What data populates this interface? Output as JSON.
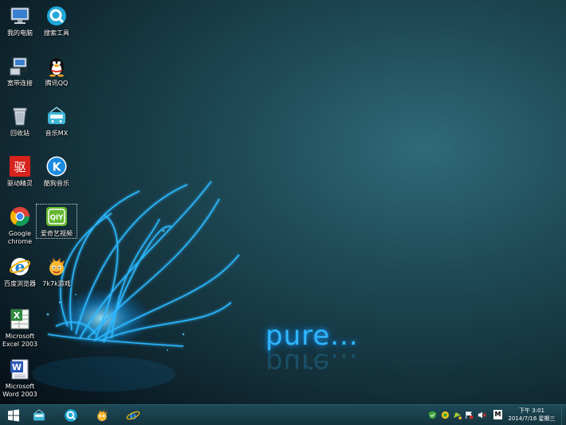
{
  "wallpaper": {
    "brand_text": "pure..."
  },
  "desktop_icons": [
    {
      "label": "我的电脑",
      "icon": "computer-icon"
    },
    {
      "label": "搜索工具",
      "icon": "search-tool-icon"
    },
    {
      "label": "宽带连接",
      "icon": "network-icon"
    },
    {
      "label": "腾讯QQ",
      "icon": "qq-penguin-icon"
    },
    {
      "label": "回收站",
      "icon": "recycle-bin-icon"
    },
    {
      "label": "音乐MX",
      "icon": "radio-icon"
    },
    {
      "label": "驱动精灵",
      "icon": "driver-genius-icon"
    },
    {
      "label": "酷狗音乐",
      "icon": "kugou-icon"
    },
    {
      "label": "Google chrome",
      "icon": "chrome-icon"
    },
    {
      "label": "爱奇艺视频",
      "icon": "iqiyi-icon"
    },
    {
      "label": "百度浏览器",
      "icon": "ie-browser-icon"
    },
    {
      "label": "7k7k游戏",
      "icon": "game-mascot-icon"
    },
    {
      "label": "Microsoft Excel 2003",
      "icon": "excel-icon"
    },
    {
      "label": "Microsoft Word 2003",
      "icon": "word-icon"
    }
  ],
  "taskbar": {
    "pinned": [
      "start-windows-icon",
      "radio-icon",
      "search-tool-icon",
      "game-mascot-icon",
      "ie-browser-icon"
    ],
    "clock": {
      "time": "下午 3:01",
      "date": "2014/7/16 星期三"
    },
    "ime_label": "M"
  },
  "colors": {
    "accent_blue": "#2fb6ff",
    "taskbar": "#1a4350"
  }
}
